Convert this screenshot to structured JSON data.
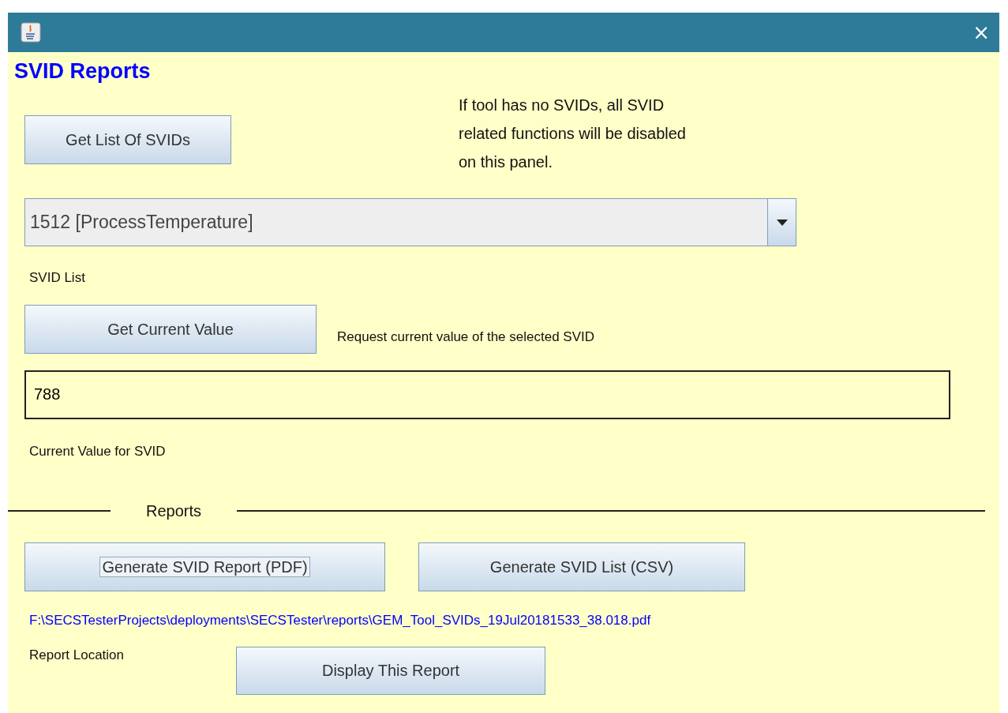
{
  "window": {
    "close_glyph": "×"
  },
  "heading": "SVID Reports",
  "get_list_button": {
    "label": "Get List Of SVIDs",
    "focused": false
  },
  "note": "If tool has no SVIDs, all SVID related functions will be disabled on this panel.",
  "svid_combo": {
    "value": "1512 [ProcessTemperature]",
    "label": "SVID List"
  },
  "get_value_button": {
    "label": "Get Current Value",
    "focused": false
  },
  "get_value_hint": "Request current value of the selected SVID",
  "current_value": {
    "value": "788",
    "label": "Current Value for SVID"
  },
  "reports_section": {
    "title": "Reports",
    "buttons": [
      {
        "label": "Generate SVID Report (PDF)",
        "focused": true
      },
      {
        "label": "Generate SVID List (CSV)",
        "focused": false
      }
    ],
    "report_path": "F:\\SECSTesterProjects\\deployments\\SECSTester\\reports\\GEM_Tool_SVIDs_19Jul20181533_38.018.pdf",
    "location_label": "Report Location",
    "display_button": {
      "label": "Display This Report",
      "focused": false
    }
  }
}
